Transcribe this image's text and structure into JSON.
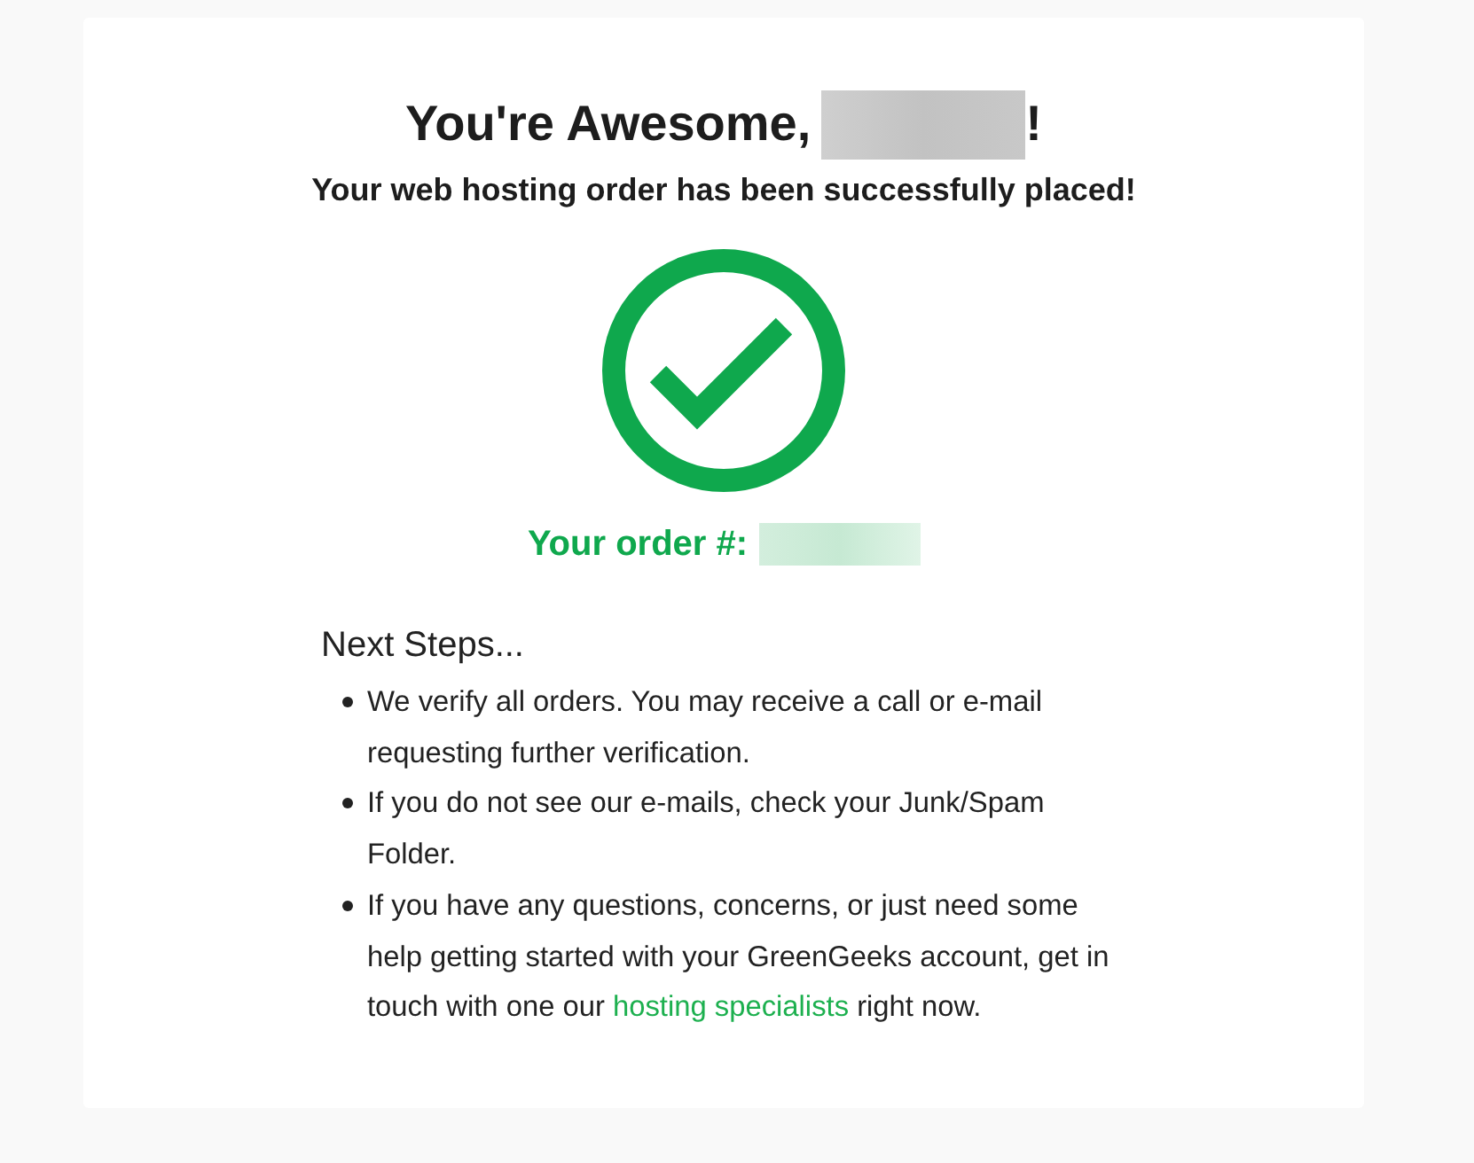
{
  "heading": {
    "title": "You're Awesome,",
    "title_end": "!",
    "subtitle": "Your web hosting order has been successfully placed!"
  },
  "order": {
    "label": "Your order #:"
  },
  "next_steps": {
    "title": "Next Steps...",
    "items": [
      {
        "parts": [
          {
            "kind": "text",
            "text": "We verify all orders. You may receive a call or e-mail requesting further verification."
          }
        ]
      },
      {
        "parts": [
          {
            "kind": "text",
            "text": "If you do not see our e-mails, check your Junk/Spam Folder."
          }
        ]
      },
      {
        "parts": [
          {
            "kind": "text",
            "text": "If you have any questions, concerns, or just need some help getting started with your GreenGeeks account, get in touch with one our "
          },
          {
            "kind": "link",
            "text": "hosting specialists"
          },
          {
            "kind": "text",
            "text": " right now."
          }
        ]
      }
    ]
  }
}
